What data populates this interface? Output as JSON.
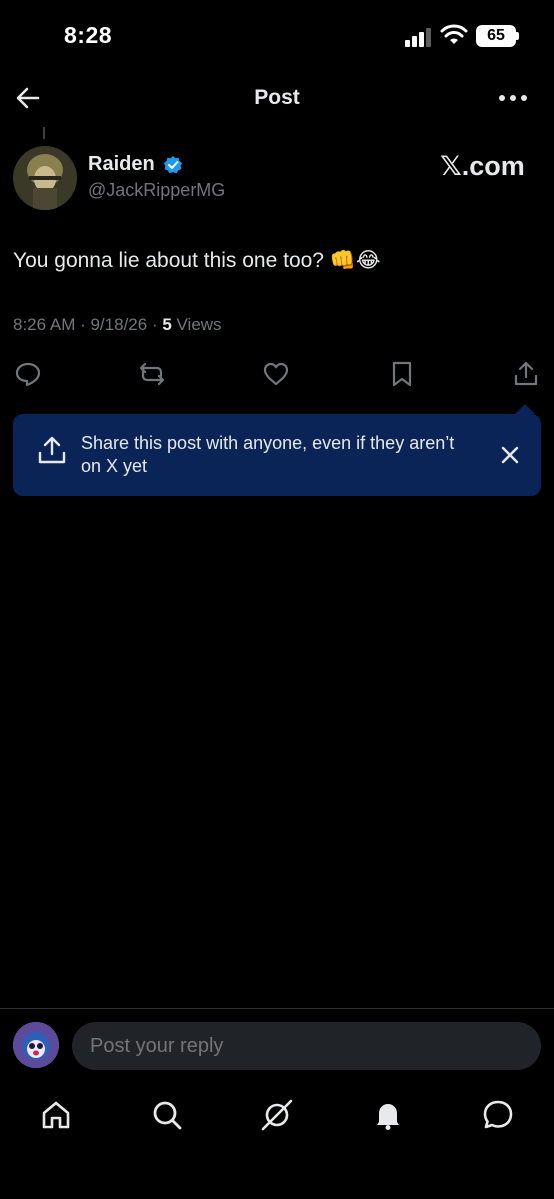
{
  "status_bar": {
    "time": "8:28",
    "battery": "65"
  },
  "header": {
    "title": "Post"
  },
  "post": {
    "author_name": "Raiden",
    "handle": "@JackRipperMG",
    "source": "𝕏.com",
    "text": "You gonna lie about this one too? 👊😂",
    "time": "8:26 AM · 9/18/26 · ",
    "views_count": "5",
    "views_label": " Views"
  },
  "share_banner": {
    "text": "Share this post with anyone, even if they aren’t on X yet"
  },
  "reply": {
    "placeholder": "Post your reply"
  },
  "colors": {
    "accent": "#1d9bf0",
    "banner_bg": "#0b2458",
    "muted": "#71767b"
  }
}
